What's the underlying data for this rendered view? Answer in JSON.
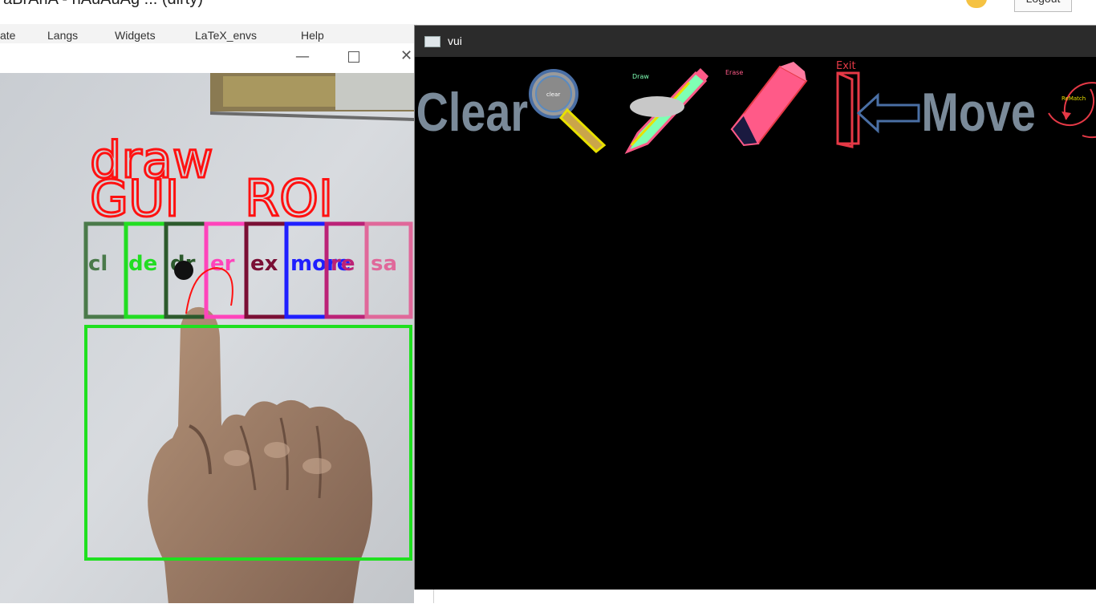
{
  "top_strip": {
    "title_partial": "aBrAriA - nAuAuAg ... (dirty)",
    "logout_partial": "Logout"
  },
  "menubar": {
    "items": [
      "ate",
      "Langs",
      "Widgets",
      "LaTeX_envs",
      "Help"
    ]
  },
  "camera_window": {
    "labels": {
      "line1": "draw",
      "line2": "GUI",
      "line3": "ROI"
    },
    "roi_boxes": [
      {
        "label": "cl",
        "color": "#4a7a4a"
      },
      {
        "label": "de",
        "color": "#22dd22"
      },
      {
        "label": "dr",
        "color": "#2c5a2c"
      },
      {
        "label": "er",
        "color": "#ff44bb"
      },
      {
        "label": "ex",
        "color": "#7a0f35"
      },
      {
        "label": "more",
        "color": "#1f1fff"
      },
      {
        "label": "re",
        "color": "#bb2277"
      },
      {
        "label": "sa",
        "color": "#e0689a"
      }
    ],
    "roi_rect_color": "#1fe01f",
    "title_color": "#ff1111"
  },
  "board_window": {
    "title": "vui",
    "tools": {
      "clear_label": "Clear",
      "magnifier_text": "clear",
      "pencil_label": "Draw",
      "eraser_label": "Erase",
      "exit_label": "Exit",
      "move_label": "Move",
      "refresh_label": "ReMatch"
    },
    "colors": {
      "clear_text": "#7a8a99",
      "move_text": "#7a8a99",
      "exit": "#e53946",
      "eraser": "#ff5a88",
      "pencil": "#7fffb4"
    }
  }
}
